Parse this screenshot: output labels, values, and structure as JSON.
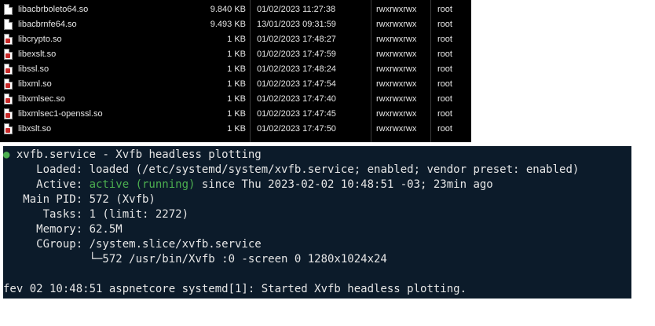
{
  "files": [
    {
      "name": "libacbrboleto64.so",
      "size": "9.840 KB",
      "changed": "01/02/2023 11:27:38",
      "rights": "rwxrwxrwx",
      "owner": "root",
      "icon": "file-icon"
    },
    {
      "name": "libacbrnfe64.so",
      "size": "9.493 KB",
      "changed": "13/01/2023 09:31:59",
      "rights": "rwxrwxrwx",
      "owner": "root",
      "icon": "file-icon"
    },
    {
      "name": "libcrypto.so",
      "size": "1 KB",
      "changed": "01/02/2023 17:48:27",
      "rights": "rwxrwxrwx",
      "owner": "root",
      "icon": "symlink-icon"
    },
    {
      "name": "libexslt.so",
      "size": "1 KB",
      "changed": "01/02/2023 17:47:59",
      "rights": "rwxrwxrwx",
      "owner": "root",
      "icon": "symlink-icon"
    },
    {
      "name": "libssl.so",
      "size": "1 KB",
      "changed": "01/02/2023 17:48:24",
      "rights": "rwxrwxrwx",
      "owner": "root",
      "icon": "symlink-icon"
    },
    {
      "name": "libxml.so",
      "size": "1 KB",
      "changed": "01/02/2023 17:47:54",
      "rights": "rwxrwxrwx",
      "owner": "root",
      "icon": "symlink-icon"
    },
    {
      "name": "libxmlsec.so",
      "size": "1 KB",
      "changed": "01/02/2023 17:47:40",
      "rights": "rwxrwxrwx",
      "owner": "root",
      "icon": "symlink-icon"
    },
    {
      "name": "libxmlsec1-openssl.so",
      "size": "1 KB",
      "changed": "01/02/2023 17:47:45",
      "rights": "rwxrwxrwx",
      "owner": "root",
      "icon": "symlink-icon"
    },
    {
      "name": "libxslt.so",
      "size": "1 KB",
      "changed": "01/02/2023 17:47:50",
      "rights": "rwxrwxrwx",
      "owner": "root",
      "icon": "symlink-icon"
    }
  ],
  "terminal": {
    "bullet": "●",
    "unit_line": " xvfb.service - Xvfb headless plotting",
    "loaded_label": "     Loaded: ",
    "loaded_value": "loaded (/etc/systemd/system/xvfb.service; enabled; vendor preset: enabled)",
    "active_label": "     Active: ",
    "active_state": "active (running)",
    "active_rest": " since Thu 2023-02-02 10:48:51 -03; 23min ago",
    "mainpid_label": "   Main PID: ",
    "mainpid_value": "572 (Xvfb)",
    "tasks_label": "      Tasks: ",
    "tasks_value": "1 (limit: 2272)",
    "memory_label": "     Memory: ",
    "memory_value": "62.5M",
    "cgroup_label": "     CGroup: ",
    "cgroup_value": "/system.slice/xvfb.service",
    "cgroup_child": "             └─572 /usr/bin/Xvfb :0 -screen 0 1280x1024x24",
    "log_line": "fev 02 10:48:51 aspnetcore systemd[1]: Started Xvfb headless plotting."
  },
  "colors": {
    "file_panel_bg": "#000000",
    "terminal_bg": "#0c1b2a",
    "status_green": "#4caf50",
    "symlink_badge": "#c62828"
  }
}
